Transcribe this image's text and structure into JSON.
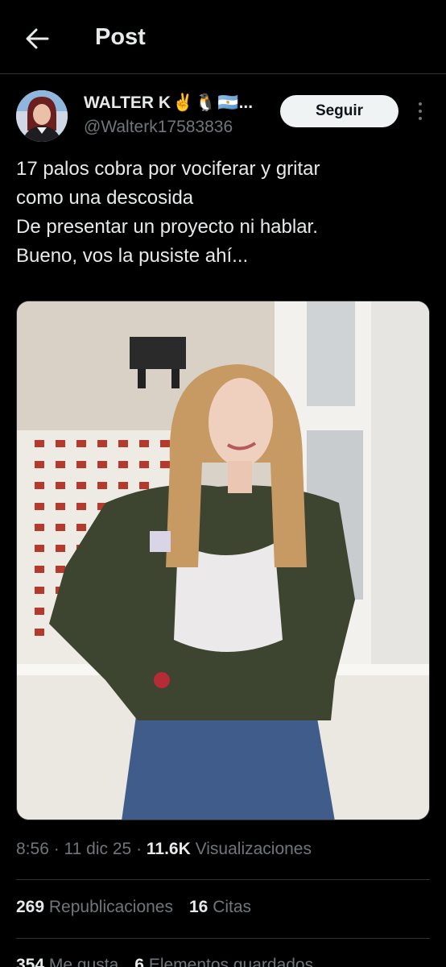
{
  "header": {
    "title": "Post",
    "back_icon": "arrow-left-icon"
  },
  "author": {
    "name": "WALTER K",
    "emojis": [
      "✌️",
      "🐧",
      "🇦🇷"
    ],
    "ellipsis": "...",
    "handle": "@Walterk17583836",
    "follow_label": "Seguir"
  },
  "tweet": {
    "lines": [
      "17 palos cobra por vociferar y gritar",
      "como una descosida",
      "De presentar un proyecto ni hablar.",
      "Bueno, vos la pusiste ahí..."
    ]
  },
  "meta": {
    "time": "8:56",
    "date": "11 dic 25",
    "views_count": "11.6K",
    "views_label": "Visualizaciones"
  },
  "stats": {
    "reposts_count": "269",
    "reposts_label": "Republicaciones",
    "quotes_count": "16",
    "quotes_label": "Citas",
    "likes_count": "354",
    "likes_label": "Me gusta",
    "bookmarks_count": "6",
    "bookmarks_label": "Elementos guardados"
  }
}
